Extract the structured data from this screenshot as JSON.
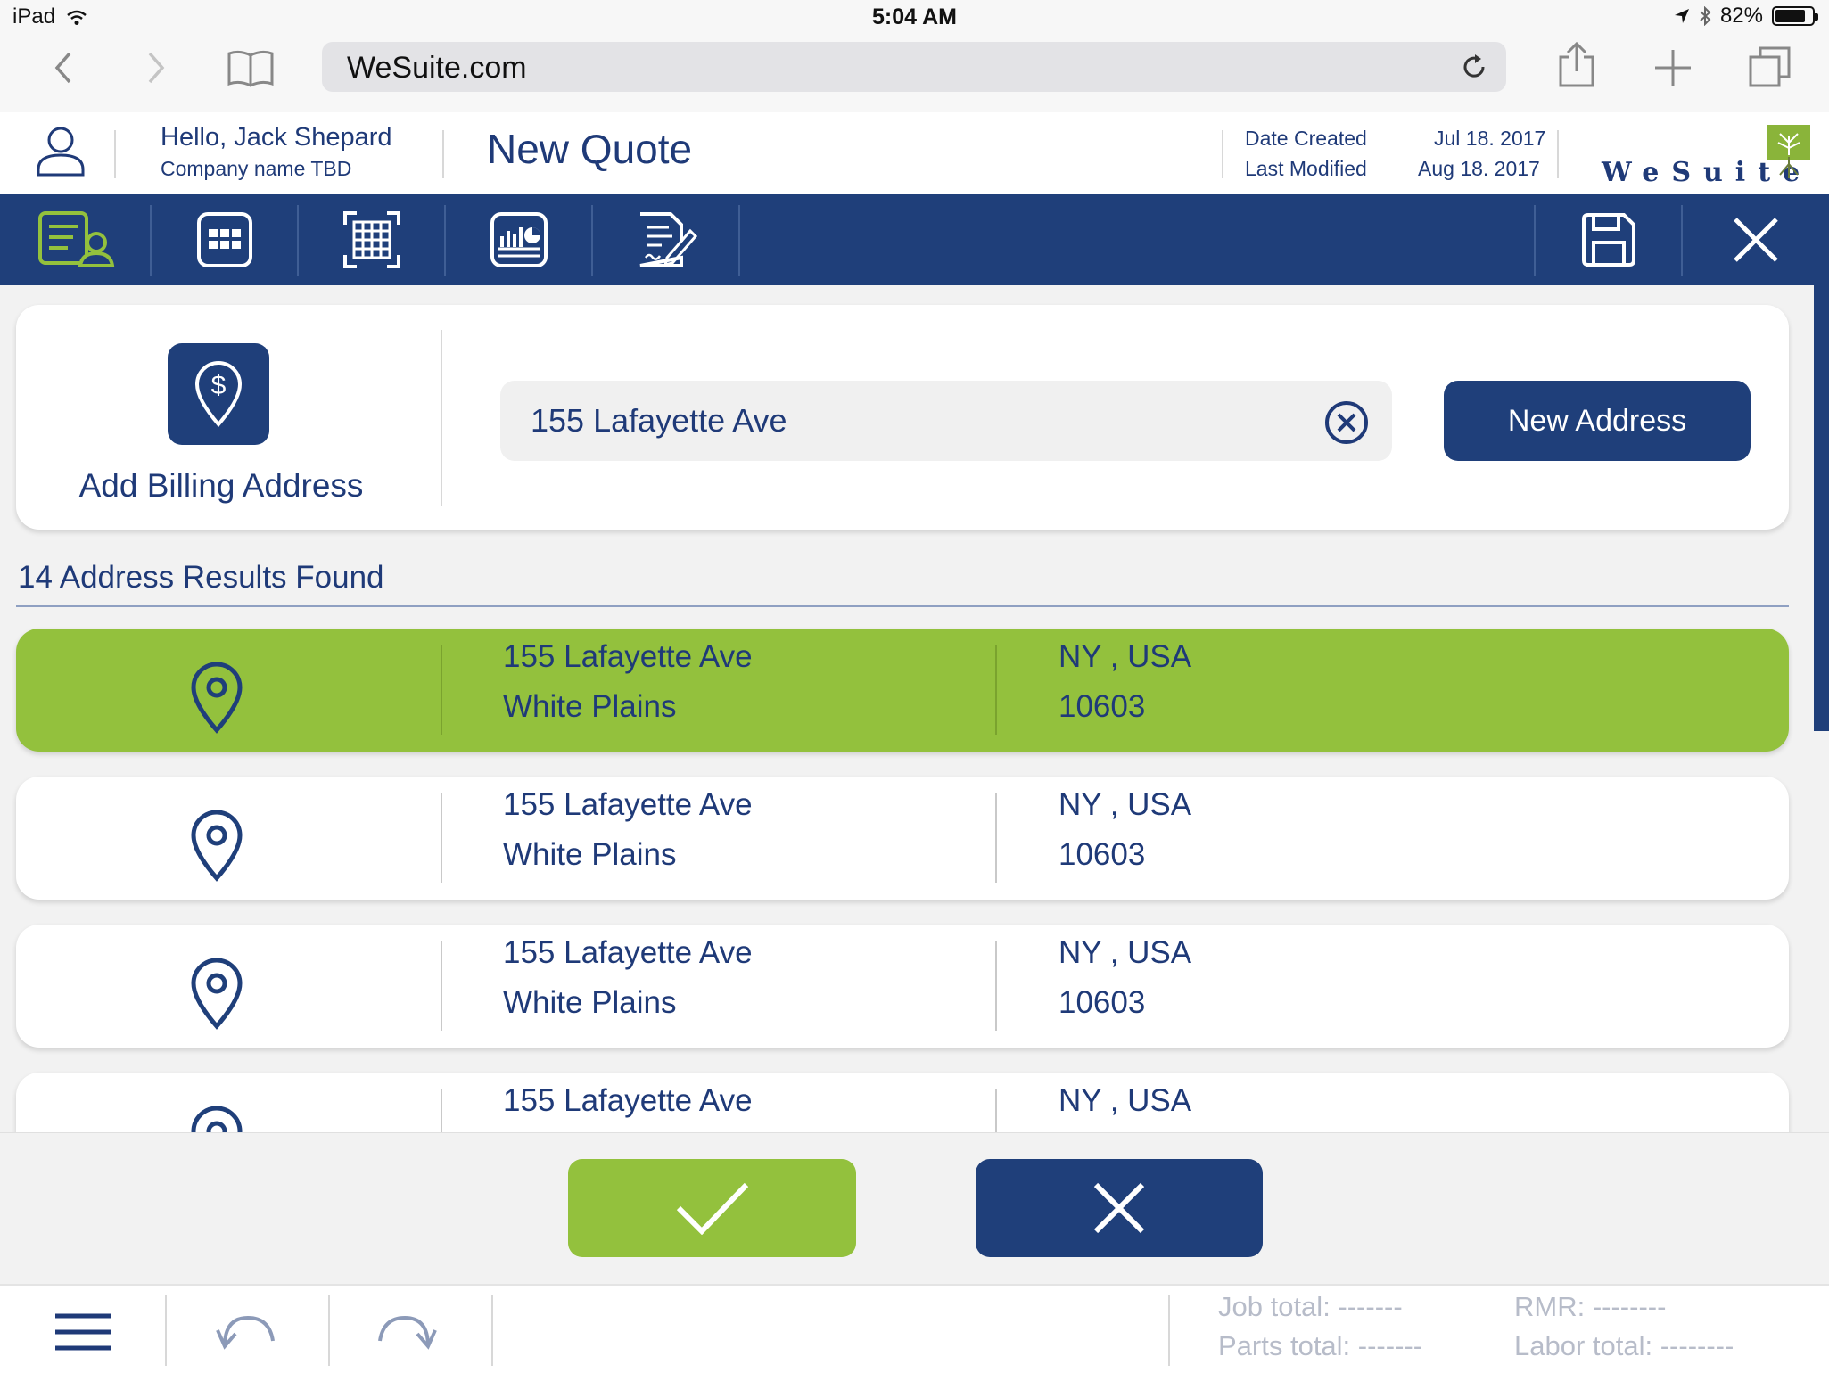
{
  "status_bar": {
    "device": "iPad",
    "time": "5:04 AM",
    "battery": "82%",
    "battery_level": 0.82
  },
  "browser": {
    "url": "WeSuite.com"
  },
  "header": {
    "greeting": "Hello, Jack Shepard",
    "company": "Company name TBD",
    "page_title": "New Quote",
    "date_created_label": "Date Created",
    "date_created_value": "Jul 18. 2017",
    "last_modified_label": "Last Modified",
    "last_modified_value": "Aug 18. 2017",
    "logo_text": "WeSuite"
  },
  "toolbar": {
    "items": [
      {
        "icon": "customer-info-icon",
        "active": true
      },
      {
        "icon": "grid-icon"
      },
      {
        "icon": "table-icon"
      },
      {
        "icon": "chart-icon"
      },
      {
        "icon": "sign-document-icon"
      }
    ],
    "save_icon": "save-icon",
    "close_icon": "close-icon"
  },
  "billing": {
    "label": "Add Billing Address",
    "search_value": "155 Lafayette Ave",
    "new_address_label": "New Address"
  },
  "results": {
    "count_label": "14 Address Results Found",
    "items": [
      {
        "street": "155 Lafayette Ave",
        "city": "White Plains",
        "state_country": "NY , USA",
        "zip": "10603",
        "selected": true
      },
      {
        "street": "155 Lafayette Ave",
        "city": "White Plains",
        "state_country": "NY , USA",
        "zip": "10603",
        "selected": false
      },
      {
        "street": "155 Lafayette Ave",
        "city": "White Plains",
        "state_country": "NY , USA",
        "zip": "10603",
        "selected": false
      },
      {
        "street": "155 Lafayette Ave",
        "city": "",
        "state_country": "NY , USA",
        "zip": "",
        "selected": false
      }
    ]
  },
  "footer": {
    "job_total": "Job total: -------",
    "parts_total": "Parts total: -------",
    "rmr": "RMR: --------",
    "labor_total": "Labor total: --------"
  },
  "colors": {
    "primary": "#1f3f7a",
    "accent_green": "#93c13d",
    "text_blue": "#1f3a78"
  }
}
